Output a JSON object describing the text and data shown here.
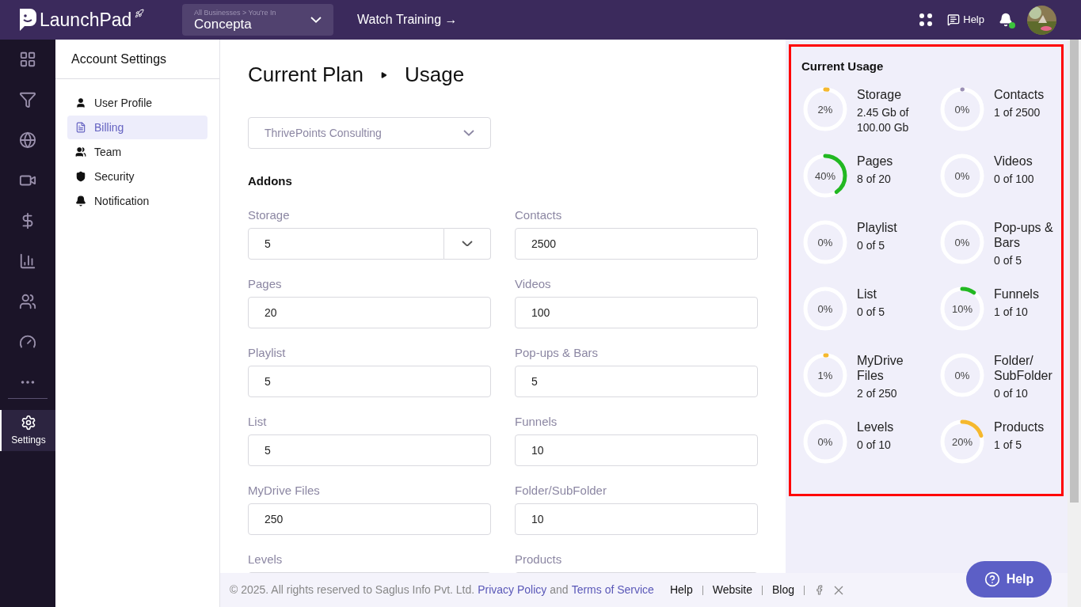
{
  "topbar": {
    "logo": "LaunchPad",
    "business_switcher": {
      "breadcrumb": "All Businesses > You're In",
      "name": "Concepta"
    },
    "training_link": "Watch Training →",
    "help": "Help",
    "notification_dot": true
  },
  "rail": {
    "items": [
      {
        "kind": "grid",
        "selected": false
      },
      {
        "kind": "funnel",
        "selected": false
      },
      {
        "kind": "globe",
        "selected": false
      },
      {
        "kind": "video",
        "selected": false
      },
      {
        "kind": "dollar",
        "selected": false
      },
      {
        "kind": "chart",
        "selected": false
      },
      {
        "kind": "people",
        "selected": false
      },
      {
        "kind": "gauge",
        "selected": false
      },
      {
        "kind": "more",
        "selected": false
      }
    ],
    "settings": {
      "label": "Settings",
      "selected": true
    }
  },
  "settings_nav": {
    "title": "Account Settings",
    "items": [
      {
        "kind": "user",
        "label": "User Profile",
        "selected": false
      },
      {
        "kind": "billing",
        "label": "Billing",
        "selected": true
      },
      {
        "kind": "team",
        "label": "Team",
        "selected": false
      },
      {
        "kind": "shield",
        "label": "Security",
        "selected": false
      },
      {
        "kind": "bell",
        "label": "Notification",
        "selected": false
      }
    ]
  },
  "main": {
    "breadcrumb": [
      "Current Plan",
      "Usage"
    ],
    "business_select": "ThrivePoints Consulting",
    "section_title": "Addons",
    "fields": [
      {
        "label": "Storage",
        "value": "5",
        "kind": "select"
      },
      {
        "label": "Contacts",
        "value": "2500",
        "kind": "text"
      },
      {
        "label": "Pages",
        "value": "20",
        "kind": "text"
      },
      {
        "label": "Videos",
        "value": "100",
        "kind": "text"
      },
      {
        "label": "Playlist",
        "value": "5",
        "kind": "text"
      },
      {
        "label": "Pop-ups & Bars",
        "value": "5",
        "kind": "text"
      },
      {
        "label": "List",
        "value": "5",
        "kind": "text"
      },
      {
        "label": "Funnels",
        "value": "10",
        "kind": "text"
      },
      {
        "label": "MyDrive Files",
        "value": "250",
        "kind": "text"
      },
      {
        "label": "Folder/SubFolder",
        "value": "10",
        "kind": "text"
      },
      {
        "label": "Levels",
        "kind": "text"
      },
      {
        "label": "Products",
        "kind": "text"
      }
    ]
  },
  "usage": {
    "title": "Current Usage",
    "highlighted": true,
    "items": [
      {
        "percent": "2%",
        "name": "Storage",
        "detail": "2.45 Gb of 100.00 Gb",
        "level": 0.02,
        "color": "#f5b82e"
      },
      {
        "percent": "0%",
        "name": "Contacts",
        "detail": "1 of 2500",
        "level": 0,
        "color": "#9b8fb5"
      },
      {
        "percent": "40%",
        "name": "Pages",
        "detail": "8 of 20",
        "level": 0.4,
        "color": "#22b822"
      },
      {
        "percent": "0%",
        "name": "Videos",
        "detail": "0 of 100",
        "level": 0
      },
      {
        "percent": "0%",
        "name": "Playlist",
        "detail": "0 of 5",
        "level": 0
      },
      {
        "percent": "0%",
        "name": "Pop-ups & Bars",
        "detail": "0 of 5",
        "level": 0
      },
      {
        "percent": "0%",
        "name": "List",
        "detail": "0 of 5",
        "level": 0
      },
      {
        "percent": "10%",
        "name": "Funnels",
        "detail": "1 of 10",
        "level": 0.1,
        "color": "#22b822"
      },
      {
        "percent": "1%",
        "name": "MyDrive Files",
        "detail": "2 of 250",
        "level": 0.01,
        "color": "#f5b82e"
      },
      {
        "percent": "0%",
        "name": "Folder/ SubFolder",
        "detail": "0 of 10",
        "level": 0
      },
      {
        "percent": "0%",
        "name": "Levels",
        "detail": "0 of 10",
        "level": 0
      },
      {
        "percent": "20%",
        "name": "Products",
        "detail": "1 of 5",
        "level": 0.2,
        "color": "#f5b82e"
      }
    ]
  },
  "footer": {
    "copyright": "©  2025. All rights reserved to Saglus Info Pvt. Ltd.",
    "privacy": "Privacy Policy",
    "and": "and",
    "terms": "Terms of Service",
    "links": [
      "Help",
      "Website",
      "Blog"
    ]
  },
  "help_button": "Help"
}
